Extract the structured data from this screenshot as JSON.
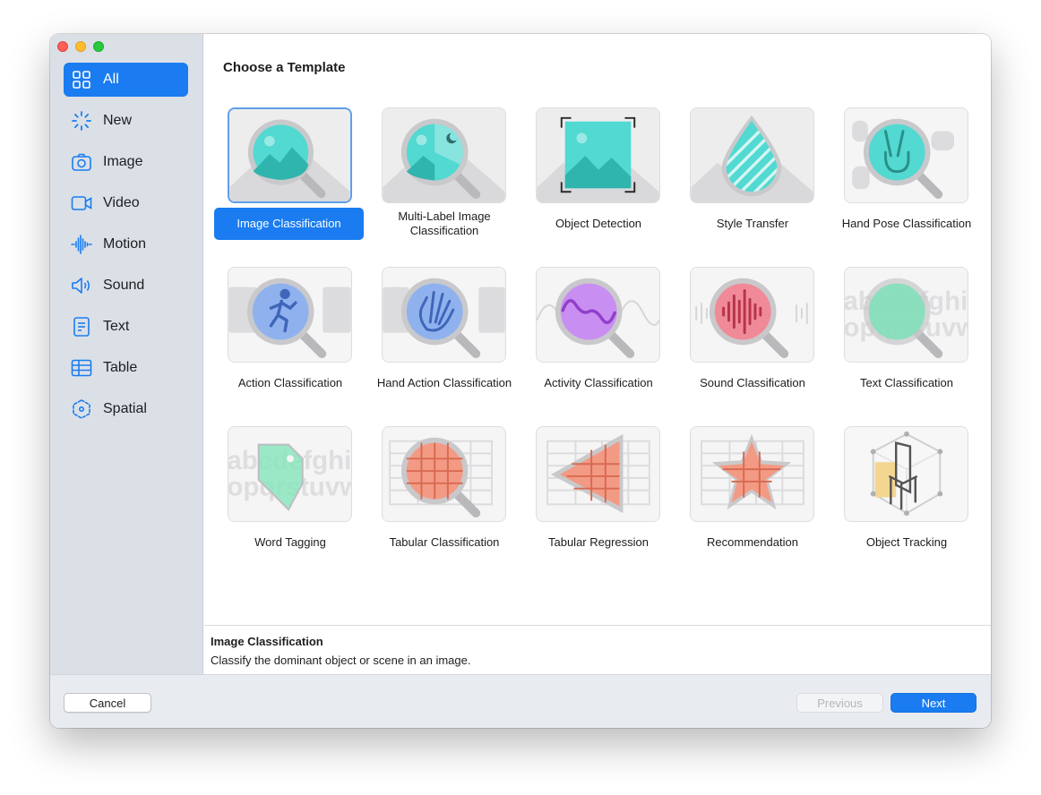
{
  "window": {
    "controls": [
      "close",
      "minimize",
      "zoom"
    ]
  },
  "sidebar": {
    "items": [
      {
        "label": "All",
        "icon": "grid-icon",
        "selected": true
      },
      {
        "label": "New",
        "icon": "spinner-icon"
      },
      {
        "label": "Image",
        "icon": "camera-icon"
      },
      {
        "label": "Video",
        "icon": "video-camera-icon"
      },
      {
        "label": "Motion",
        "icon": "waveform-icon"
      },
      {
        "label": "Sound",
        "icon": "speaker-icon"
      },
      {
        "label": "Text",
        "icon": "document-icon"
      },
      {
        "label": "Table",
        "icon": "table-icon"
      },
      {
        "label": "Spatial",
        "icon": "cube-icon"
      }
    ]
  },
  "main": {
    "title": "Choose a Template",
    "templates": [
      {
        "label": "Image Classification",
        "icon": "image-magnifier-icon",
        "selected": true
      },
      {
        "label": "Multi-Label Image Classification",
        "icon": "multilabel-magnifier-icon"
      },
      {
        "label": "Object Detection",
        "icon": "object-detection-icon"
      },
      {
        "label": "Style Transfer",
        "icon": "style-drop-icon"
      },
      {
        "label": "Hand Pose Classification",
        "icon": "hand-pose-icon"
      },
      {
        "label": "Action Classification",
        "icon": "action-runner-icon"
      },
      {
        "label": "Hand Action Classification",
        "icon": "hand-wave-icon"
      },
      {
        "label": "Activity Classification",
        "icon": "activity-wave-icon"
      },
      {
        "label": "Sound Classification",
        "icon": "sound-wave-icon"
      },
      {
        "label": "Text Classification",
        "icon": "text-magnifier-icon"
      },
      {
        "label": "Word Tagging",
        "icon": "word-tag-icon"
      },
      {
        "label": "Tabular Classification",
        "icon": "table-magnifier-icon"
      },
      {
        "label": "Tabular Regression",
        "icon": "table-triangle-icon"
      },
      {
        "label": "Recommendation",
        "icon": "star-table-icon"
      },
      {
        "label": "Object Tracking",
        "icon": "object-tracking-icon"
      }
    ],
    "thumb_texts": {
      "letters_top": "abcdefghi",
      "letters_bottom": "opqrstuvw"
    }
  },
  "description": {
    "title": "Image Classification",
    "text": "Classify the dominant object or scene in an image."
  },
  "footer": {
    "cancel": "Cancel",
    "previous": "Previous",
    "next": "Next"
  },
  "colors": {
    "accent": "#1a7cf0",
    "teal": "#3fd1c8",
    "sidebar": "#dbe0e7"
  }
}
